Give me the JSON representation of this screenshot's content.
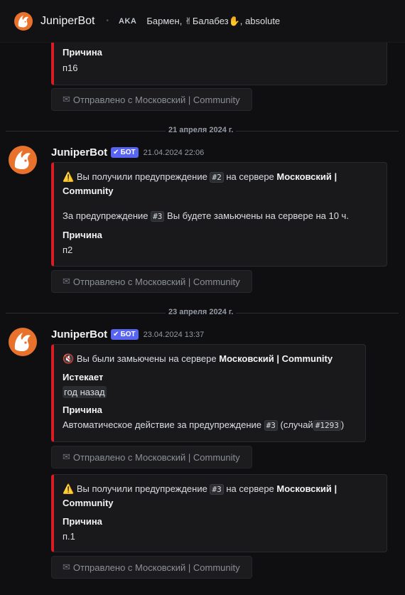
{
  "header": {
    "name": "JuniperBot",
    "aka_label": "AKA",
    "nicknames": "Бармен, ✌Балабез✋, absolute"
  },
  "top_embed": {
    "reason_label": "Причина",
    "reason_value": "п16"
  },
  "source_button": "Отправлено с Московский | Community",
  "dividers": [
    "21 апреля 2024 г.",
    "23 апреля 2024 г."
  ],
  "messages": [
    {
      "author": "JuniperBot",
      "badge": "БОТ",
      "timestamp": "21.04.2024 22:06",
      "embed": {
        "icon": "warning-icon",
        "text_prefix": "Вы получили предупреждение",
        "warn_num": "#2",
        "text_mid": "на сервере",
        "server": "Московский |",
        "server2": "Community",
        "note_prefix": "За предупреждение",
        "note_num": "#3",
        "note_suffix": "Вы будете замьючены на сервере на 10 ч.",
        "reason_label": "Причина",
        "reason_value": "п2"
      }
    },
    {
      "author": "JuniperBot",
      "badge": "БОТ",
      "timestamp": "23.04.2024 13:37",
      "embed": {
        "icon": "muted-speaker-icon",
        "text_prefix": "Вы были замьючены на сервере",
        "server": "Московский | Community",
        "expires_label": "Истекает",
        "expires_value": "год назад",
        "reason_label": "Причина",
        "reason_prefix": "Автоматическое действие за предупреждение",
        "reason_num": "#3",
        "case_prefix": "(случай",
        "case_num": "#1293",
        "case_suffix": ")"
      },
      "embed2": {
        "icon": "warning-icon",
        "text_prefix": "Вы получили предупреждение",
        "warn_num": "#3",
        "text_mid": "на сервере",
        "server": "Московский |",
        "server2": "Community",
        "reason_label": "Причина",
        "reason_value": "п.1"
      }
    }
  ]
}
